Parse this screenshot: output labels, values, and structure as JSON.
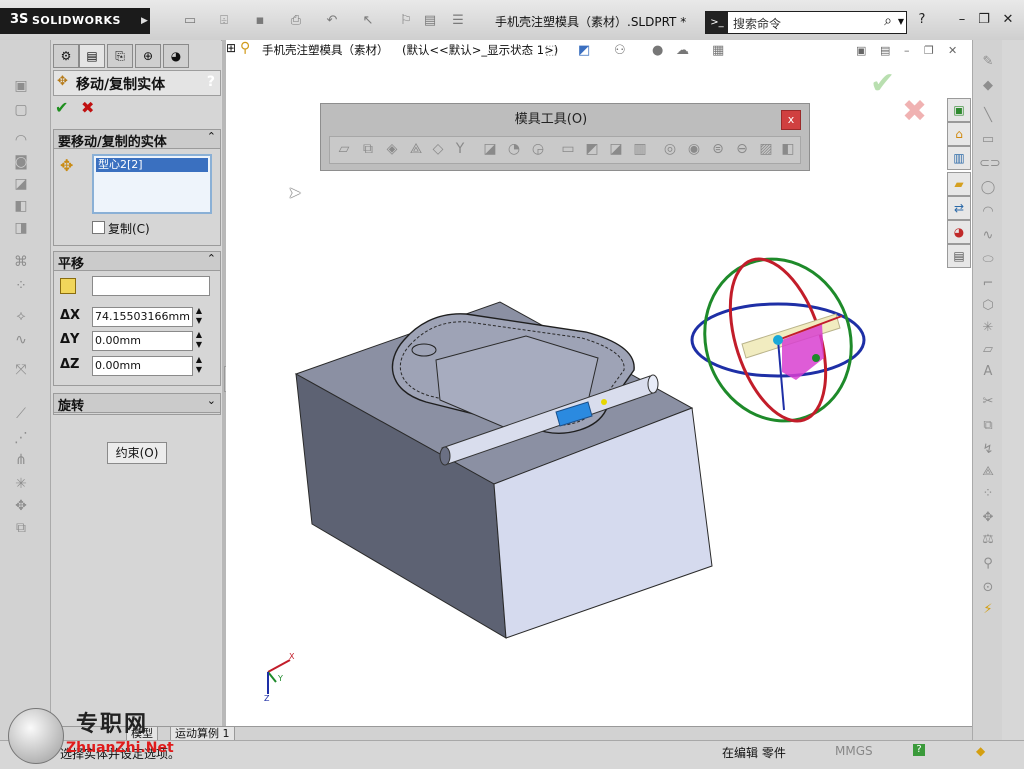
{
  "app": {
    "brand_ds": "3S",
    "brand_name": "SOLIDWORKS",
    "doc_title": "手机壳注塑模具（素材）.SLDPRT *",
    "search_placeholder": "搜索命令",
    "search_cmd_icon": ">_"
  },
  "panel": {
    "title": "移动/复制实体",
    "help": "?",
    "group_bodies": {
      "title": "要移动/复制的实体",
      "selected_item": "型心2[2]",
      "copy_label": "复制(C)"
    },
    "group_translate": {
      "title": "平移",
      "target_value": "",
      "dx_label": "ΔX",
      "dx_value": "74.15503166mm",
      "dy_label": "ΔY",
      "dy_value": "0.00mm",
      "dz_label": "ΔZ",
      "dz_value": "0.00mm"
    },
    "group_rotate": {
      "title": "旋转"
    },
    "constrain_button": "约束(O)"
  },
  "viewport": {
    "tree_title": "手机壳注塑模具（素材）",
    "tree_config": "(默认<<默认>_显示状态 1>)"
  },
  "mold_toolbar": {
    "title": "模具工具(O)",
    "close": "x"
  },
  "tabs": {
    "model": "模型",
    "motion": "运动算例 1"
  },
  "status": {
    "message": "选择实体并设定选项。",
    "editing": "在编辑 零件",
    "units": "MMGS",
    "help": "?"
  },
  "triad": {
    "x": "X",
    "y": "Y",
    "z": "Z"
  },
  "watermark": {
    "text": "专职网",
    "url": "ZhuanZhi.Net"
  },
  "colors": {
    "titlebar_bg": "#d9d9d9",
    "panel_bg": "#d6d6d6",
    "accent_blue": "#3a70c0",
    "ok_green": "#1e8f1e",
    "cancel_red": "#c01010",
    "ring_red": "#c21d2a",
    "ring_green": "#1e8a2a",
    "ring_blue": "#1e2fa6",
    "mold_top": "#8e93a6",
    "mold_side_left": "#606577",
    "mold_side_right": "#d5daee"
  }
}
